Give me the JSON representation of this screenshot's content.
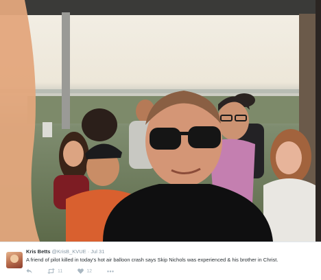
{
  "photo": {
    "description_icon": "selfie-photo"
  },
  "tweet": {
    "author_name": "Kris Betts",
    "author_handle": "@KrisB_KVUE",
    "separator": "·",
    "date": "Jul 31",
    "text": "A friend of pilot killed in today's hot air balloon crash says Skip Nichols was experienced & his brother in Christ.",
    "actions": {
      "reply_icon": "reply-icon",
      "retweet_icon": "retweet-icon",
      "retweet_count": "11",
      "like_icon": "heart-icon",
      "like_count": "12",
      "more_icon": "more-icon"
    }
  },
  "colors": {
    "name": "#292f33",
    "secondary": "#8899a6",
    "action": "#aab8c2",
    "divider": "#e1e8ed"
  }
}
